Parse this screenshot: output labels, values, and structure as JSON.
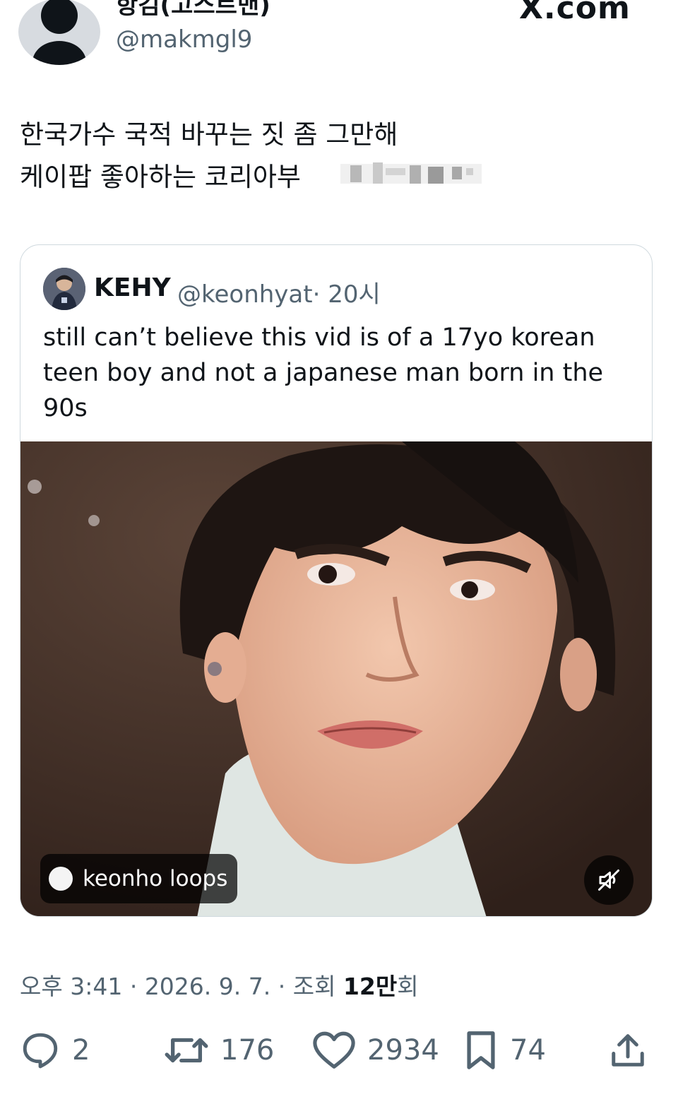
{
  "header": {
    "display_name": "항김(고스트맨)",
    "handle": "@makmgl9",
    "site_logo": "X.com"
  },
  "tweet": {
    "lines": [
      "한국가수 국적 바꾸는 짓 좀 그만해",
      "케이팝 좋아하는 코리아부"
    ]
  },
  "quote": {
    "name": "KEHY",
    "handle": "@keonhyat",
    "time": "· 20시",
    "text": "still can’t believe this vid is of a 17yo korean teen boy and not a japanese man born in the 90s",
    "media_label": "keonho loops",
    "mute_icon": "speaker-muted-icon"
  },
  "meta": {
    "time": "오후 3:41",
    "sep1": " · ",
    "date": "2026. 9. 7.",
    "sep2": " · ",
    "views_prefix": "조회 ",
    "views_value": "12만",
    "views_suffix": "회"
  },
  "actions": {
    "replies": "2",
    "retweets": "176",
    "likes": "2934",
    "bookmarks": "74"
  },
  "colors": {
    "text": "#0f1419",
    "secondary": "#536471",
    "border": "#cfd9de"
  }
}
